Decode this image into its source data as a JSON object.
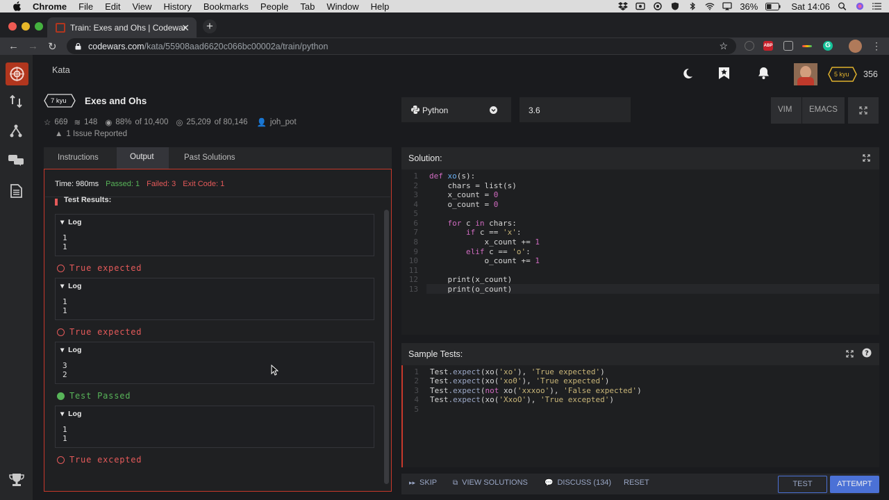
{
  "menubar": {
    "items": [
      "Chrome",
      "File",
      "Edit",
      "View",
      "History",
      "Bookmarks",
      "People",
      "Tab",
      "Window",
      "Help"
    ],
    "battery": "36%",
    "clock": "Sat 14:06"
  },
  "browser": {
    "tab_title": "Train: Exes and Ohs | Codewar",
    "url_host": "codewars.com",
    "url_path": "/kata/55908aad6620c066bc00002a/train/python"
  },
  "header": {
    "nav_kata": "Kata",
    "rank_badge": "5 kyu",
    "honor": "356"
  },
  "kata": {
    "kyu": "7 kyu",
    "title": "Exes and Ohs",
    "stars": "669",
    "collections": "148",
    "satisfaction": "88%",
    "satisfaction_of": "of 10,400",
    "completed": "25,209",
    "completed_of": "of 80,146",
    "author": "joh_pot",
    "issues": "1 Issue Reported"
  },
  "editor_bar": {
    "language": "Python",
    "version": "3.6",
    "vim": "VIM",
    "emacs": "EMACS"
  },
  "tabs": {
    "instructions": "Instructions",
    "output": "Output",
    "past": "Past Solutions"
  },
  "output": {
    "time": "Time: 980ms",
    "passed": "Passed: 1",
    "failed": "Failed: 3",
    "exit": "Exit Code: 1",
    "heading": "Test Results:",
    "log_label": "Log",
    "logs": [
      {
        "l1": "1",
        "l2": "1"
      },
      {
        "l1": "1",
        "l2": "1"
      },
      {
        "l1": "3",
        "l2": "2"
      },
      {
        "l1": "1",
        "l2": "1"
      }
    ],
    "results": [
      "True expected",
      "True expected",
      "Test Passed",
      "True excepted"
    ]
  },
  "solution": {
    "title": "Solution:",
    "line_numbers": [
      "1",
      "2",
      "3",
      "4",
      "5",
      "6",
      "7",
      "8",
      "9",
      "10",
      "11",
      "12",
      "13"
    ]
  },
  "code": {
    "l1a": "def ",
    "l1b": "xo",
    "l1c": "(s):",
    "l2a": "    chars = ",
    "l2b": "list",
    "l2c": "(s)",
    "l3a": "    x_count = ",
    "l3b": "0",
    "l4a": "    o_count = ",
    "l4b": "0",
    "l6a": "    ",
    "l6b": "for",
    "l6c": " c ",
    "l6d": "in",
    "l6e": " chars:",
    "l7a": "        ",
    "l7b": "if",
    "l7c": " c == ",
    "l7d": "'x'",
    "l7e": ":",
    "l8a": "            x_count += ",
    "l8b": "1",
    "l9a": "        ",
    "l9b": "elif",
    "l9c": " c == ",
    "l9d": "'o'",
    "l9e": ":",
    "l10a": "            o_count += ",
    "l10b": "1",
    "l12a": "    ",
    "l12b": "print",
    "l12c": "(x_count)",
    "l13a": "    ",
    "l13b": "print",
    "l13c": "(o_count)"
  },
  "sample": {
    "title": "Sample Tests:",
    "line_numbers": [
      "1",
      "2",
      "3",
      "4",
      "5"
    ],
    "t1a": "Test",
    "t1b": ".expect",
    "t1c": "(xo(",
    "t1d": "'xo'",
    "t1e": "), ",
    "t1f": "'True expected'",
    "t1g": ")",
    "t2a": "Test",
    "t2b": ".expect",
    "t2c": "(xo(",
    "t2d": "'xo0'",
    "t2e": "), ",
    "t2f": "'True expected'",
    "t2g": ")",
    "t3a": "Test",
    "t3b": ".expect",
    "t3c": "(",
    "t3d": "not",
    "t3e": " xo(",
    "t3f": "'xxxoo'",
    "t3g": "), ",
    "t3h": "'False expected'",
    "t3i": ")",
    "t4a": "Test",
    "t4b": ".expect",
    "t4c": "(xo(",
    "t4d": "'XxoO'",
    "t4e": "), ",
    "t4f": "'True excepted'",
    "t4g": ")"
  },
  "actions": {
    "skip": "SKIP",
    "view_solutions": "VIEW SOLUTIONS",
    "discuss": "DISCUSS (134)",
    "reset": "RESET",
    "test": "TEST",
    "attempt": "ATTEMPT"
  },
  "colors": {
    "accent_red": "#b1361e",
    "pass_green": "#4caf50",
    "fail_red": "#e55a5a",
    "attempt_blue": "#4b71d6",
    "test_border": "#4b71d6"
  }
}
